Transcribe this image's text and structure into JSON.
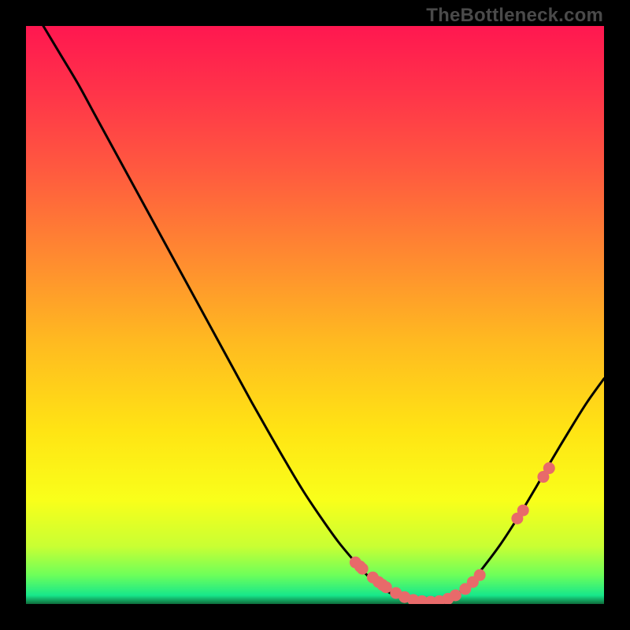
{
  "watermark": "TheBottleneck.com",
  "colors": {
    "dot": "#e86a6a",
    "line": "#000000"
  },
  "gradient_stops": [
    {
      "offset": 0.0,
      "color": "#ff1750"
    },
    {
      "offset": 0.12,
      "color": "#ff3549"
    },
    {
      "offset": 0.25,
      "color": "#ff5a3f"
    },
    {
      "offset": 0.4,
      "color": "#ff8a30"
    },
    {
      "offset": 0.55,
      "color": "#ffbb20"
    },
    {
      "offset": 0.7,
      "color": "#ffe414"
    },
    {
      "offset": 0.82,
      "color": "#f9ff1a"
    },
    {
      "offset": 0.9,
      "color": "#c9ff33"
    },
    {
      "offset": 0.95,
      "color": "#6dff5a"
    },
    {
      "offset": 0.985,
      "color": "#17e88b"
    },
    {
      "offset": 1.0,
      "color": "#0f6b3b"
    }
  ],
  "chart_data": {
    "type": "line",
    "title": "",
    "xlabel": "",
    "ylabel": "",
    "xlim": [
      0,
      100
    ],
    "ylim": [
      0,
      100
    ],
    "series": [
      {
        "name": "bottleneck-curve",
        "x": [
          0,
          3,
          6,
          9,
          12,
          15,
          18,
          21,
          24,
          27,
          30,
          33,
          36,
          39,
          42,
          45,
          48,
          51,
          54,
          57,
          59,
          61,
          63,
          65,
          67,
          69,
          71,
          73,
          75,
          77,
          79,
          82,
          85,
          88,
          91,
          94,
          97,
          100
        ],
        "y": [
          105,
          100,
          95,
          90,
          84.5,
          79,
          73.5,
          68,
          62.5,
          57,
          51.5,
          46,
          40.5,
          35,
          29.7,
          24.5,
          19.5,
          15,
          10.8,
          7.2,
          5.0,
          3.2,
          1.9,
          1.1,
          0.6,
          0.4,
          0.5,
          1.0,
          2.0,
          3.8,
          6.2,
          10.2,
          14.8,
          19.8,
          25.0,
          30.0,
          34.8,
          39.0
        ]
      }
    ],
    "dots": {
      "x": [
        57.0,
        57.8,
        58.2,
        60.0,
        61.0,
        61.7,
        62.3,
        64.0,
        65.5,
        67.0,
        68.5,
        70.0,
        71.5,
        73.0,
        74.3,
        76.0,
        77.3,
        78.5,
        85.0,
        86.0,
        89.5,
        90.5
      ],
      "y": [
        7.2,
        6.5,
        6.1,
        4.6,
        3.8,
        3.3,
        2.9,
        1.9,
        1.2,
        0.7,
        0.5,
        0.4,
        0.5,
        0.9,
        1.5,
        2.6,
        3.8,
        5.0,
        14.8,
        16.2,
        22.0,
        23.5
      ]
    }
  }
}
